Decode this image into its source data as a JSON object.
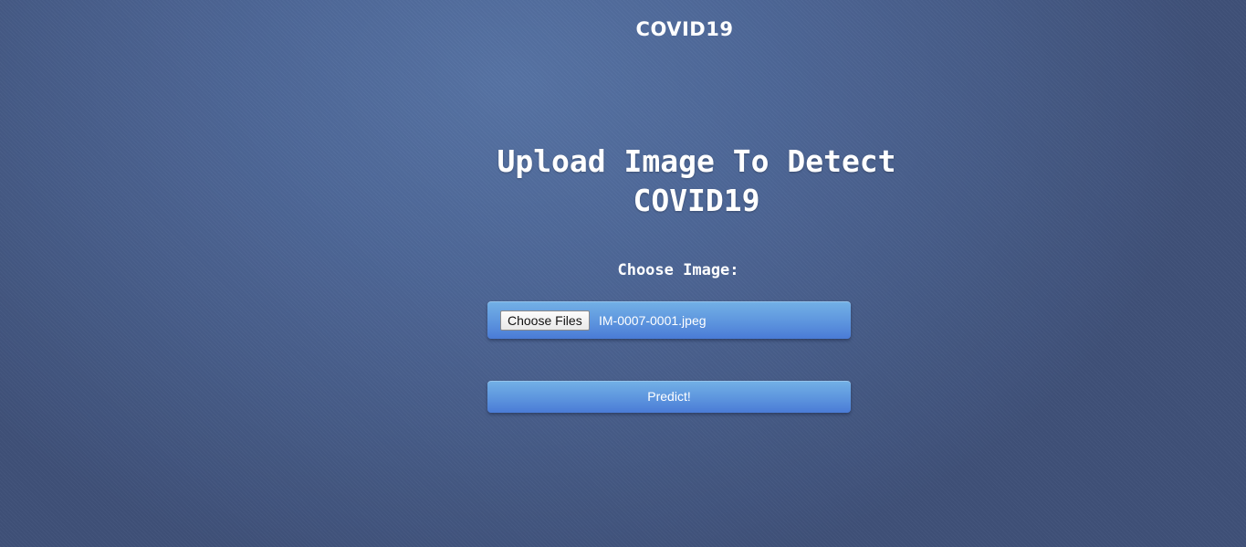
{
  "header": {
    "site_title": "COVID19"
  },
  "main": {
    "heading": "Upload Image To Detect COVID19",
    "choose_label": "Choose Image:",
    "file_input": {
      "button_label": "Choose Files",
      "selected_file": "IM-0007-0001.jpeg"
    },
    "predict_label": "Predict!"
  },
  "colors": {
    "background": "#4e6797",
    "button_top": "#73b1e6",
    "button_bottom": "#4a7bd6",
    "text": "#ffffff"
  }
}
